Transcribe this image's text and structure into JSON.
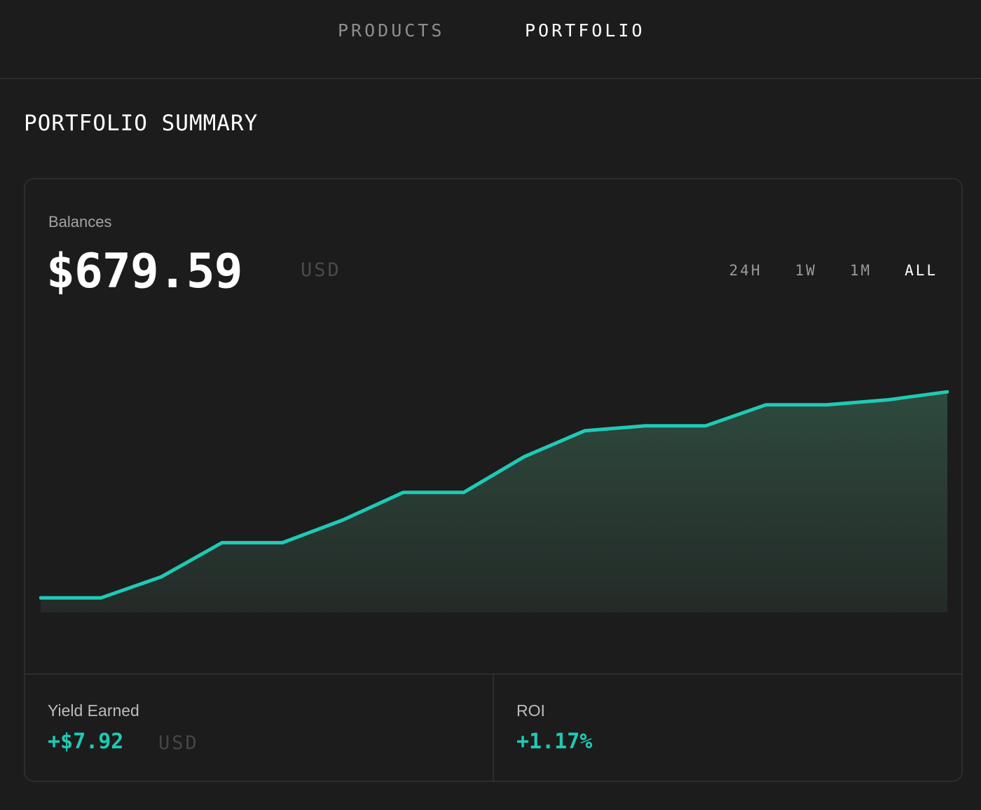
{
  "nav": {
    "tabs": [
      {
        "label": "PRODUCTS",
        "active": false
      },
      {
        "label": "PORTFOLIO",
        "active": true
      }
    ]
  },
  "page": {
    "title": "PORTFOLIO SUMMARY"
  },
  "balances": {
    "label": "Balances",
    "amount": "$679.59",
    "unit": "USD"
  },
  "ranges": {
    "options": [
      "24H",
      "1W",
      "1M",
      "ALL"
    ],
    "selected": "ALL"
  },
  "chart_data": {
    "type": "area",
    "title": "",
    "xlabel": "",
    "ylabel": "",
    "grid": false,
    "legend": "none",
    "x": [
      0,
      1,
      2,
      3,
      4,
      5,
      6,
      7,
      8,
      9,
      10,
      11,
      12,
      13,
      14,
      15
    ],
    "series": [
      {
        "values": [
          672.0,
          672.0,
          673.3,
          675.4,
          675.4,
          676.8,
          678.5,
          678.5,
          680.7,
          682.3,
          682.6,
          682.6,
          683.9,
          683.9,
          684.2,
          684.7
        ],
        "line_color": "#1ecab5",
        "fill_top_color": "#2e4a3e",
        "fill_bottom_color": "#242a27"
      }
    ],
    "ylim": [
      671.1,
      687.0
    ]
  },
  "stats": {
    "yield": {
      "label": "Yield Earned",
      "value": "+$7.92",
      "unit": "USD"
    },
    "roi": {
      "label": "ROI",
      "value": "+1.17%"
    }
  },
  "colors": {
    "background": "#1c1c1c",
    "accent": "#1ecab5",
    "border": "#2d2d2d",
    "muted_text": "#8e8e8e"
  }
}
